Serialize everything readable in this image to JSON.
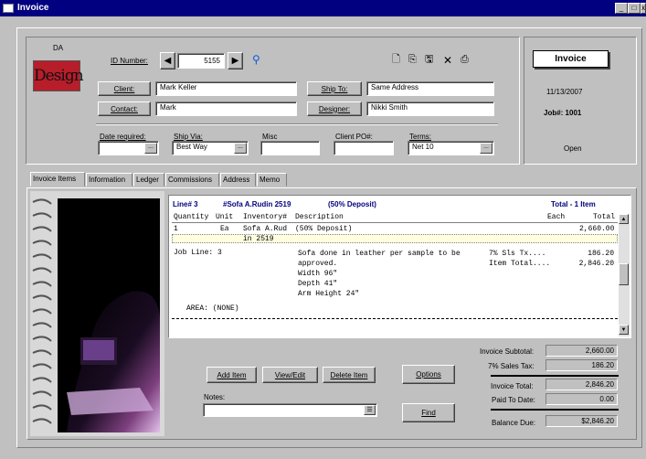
{
  "window": {
    "title": "Invoice"
  },
  "logo": {
    "top": "DA",
    "word": "Design"
  },
  "header": {
    "id_label": "ID Number:",
    "id_value": "5155",
    "client_label": "Client:",
    "client_value": "Mark Keller",
    "contact_label": "Contact:",
    "contact_value": "Mark",
    "ship_to_label": "Ship To:",
    "ship_to_value": "Same Address",
    "designer_label": "Designer:",
    "designer_value": "Nikki Smith",
    "date_required_label": "Date required:",
    "date_required_value": "",
    "ship_via_label": "Ship Via:",
    "ship_via_value": "Best Way",
    "misc_label": "Misc",
    "misc_value": "",
    "client_po_label": "Client PO#:",
    "client_po_value": "",
    "terms_label": "Terms:",
    "terms_value": "Net 10",
    "dots": "..."
  },
  "status_panel": {
    "type": "Invoice",
    "date": "11/13/2007",
    "job": "Job#: 1001",
    "status": "Open"
  },
  "tabs": [
    "Invoice Items",
    "Information",
    "Ledger",
    "Commissions",
    "Address",
    "Memo"
  ],
  "items": {
    "line_heading": "Line# 3",
    "item_name": "#Sofa A.Rudin 2519",
    "deposit": "(50% Deposit)",
    "total_heading": "Total - 1 Item",
    "columns": [
      "Quantity",
      "Unit",
      "Inventory#",
      "Description",
      "Each",
      "Total"
    ],
    "row": {
      "qty": "1",
      "unit": "Ea",
      "inventory": "Sofa A.Rud",
      "inventory_cont": "in 2519",
      "description": "(50% Deposit)",
      "each": "",
      "total": "2,660.00"
    },
    "job_line": "Job Line: 3",
    "details": [
      "Sofa done in leather per sample to be",
      "approved.",
      "Width 96\"",
      "Depth 41\"",
      "Arm Height 24\""
    ],
    "tax_labels": [
      "7% Sls Tx....",
      "Item Total...."
    ],
    "tax_values": [
      "186.20",
      "2,846.20"
    ],
    "area": "AREA: (NONE)"
  },
  "actions": {
    "add": "Add Item",
    "view": "View/Edit",
    "delete": "Delete Item",
    "options": "Options",
    "find": "Find",
    "notes_label": "Notes:"
  },
  "summary": {
    "subtotal_label": "Invoice Subtotal:",
    "subtotal": "2,660.00",
    "tax_label": "7% Sales Tax:",
    "tax": "186.20",
    "total_label": "Invoice Total:",
    "total": "2,846.20",
    "paid_label": "Paid To Date:",
    "paid": "0.00",
    "balance_label": "Balance Due:",
    "balance": "$2,846.20"
  },
  "colors": {
    "titlebar": "#000080",
    "heading": "#000080",
    "logo_bg": "#b81d2a"
  }
}
